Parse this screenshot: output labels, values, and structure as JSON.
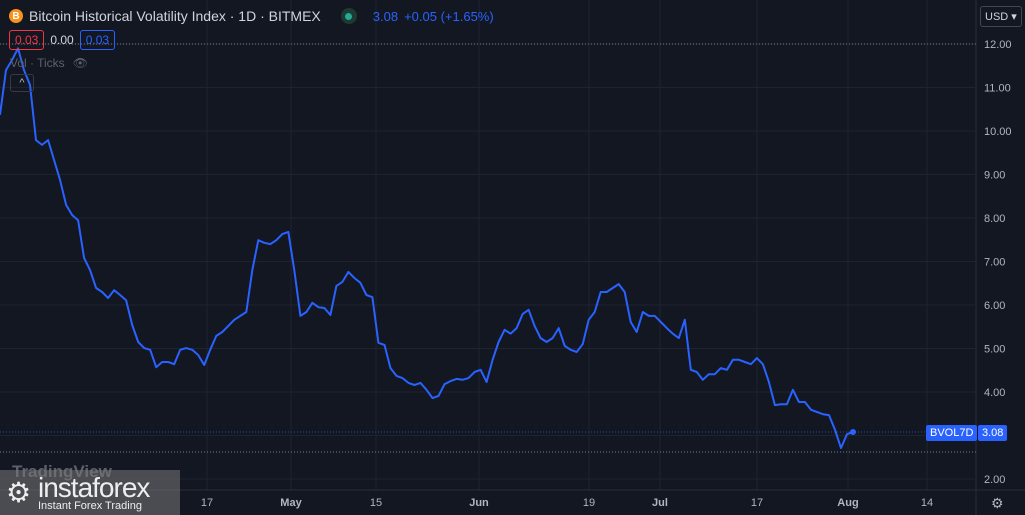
{
  "header": {
    "title": "Bitcoin Historical Volatility Index · 1D · BITMEX",
    "coin_icon": "B",
    "last": "3.08",
    "change": "+0.05 (+1.65%)",
    "box1": "0.03",
    "mid": "0.00",
    "box2": "0.03",
    "vol_label": "Vol · Ticks",
    "currency": "USD"
  },
  "price_tag": {
    "symbol": "BVOL7D",
    "value": "3.08"
  },
  "watermark": {
    "tv": "TradingView",
    "brand": "instaforex",
    "tagline": "Instant Forex Trading"
  },
  "chart_data": {
    "type": "line",
    "series": [
      {
        "name": "BVOL7D",
        "color": "#2962ff",
        "values": [
          10.37,
          11.4,
          11.63,
          11.9,
          11.4,
          11.06,
          9.79,
          9.68,
          9.79,
          9.33,
          8.87,
          8.3,
          8.07,
          7.95,
          7.08,
          6.8,
          6.39,
          6.3,
          6.16,
          6.34,
          6.23,
          6.11,
          5.54,
          5.15,
          5.01,
          4.97,
          4.57,
          4.69,
          4.69,
          4.64,
          4.97,
          5.01,
          4.97,
          4.85,
          4.62,
          4.97,
          5.29,
          5.38,
          5.52,
          5.66,
          5.75,
          5.84,
          6.8,
          7.49,
          7.43,
          7.4,
          7.49,
          7.63,
          7.68,
          6.8,
          5.75,
          5.84,
          6.05,
          5.95,
          5.93,
          5.77,
          6.44,
          6.53,
          6.76,
          6.62,
          6.51,
          6.23,
          6.18,
          5.13,
          5.08,
          4.55,
          4.37,
          4.32,
          4.21,
          4.16,
          4.21,
          4.05,
          3.86,
          3.91,
          4.18,
          4.25,
          4.3,
          4.28,
          4.32,
          4.46,
          4.51,
          4.23,
          4.74,
          5.15,
          5.43,
          5.34,
          5.47,
          5.79,
          5.89,
          5.52,
          5.24,
          5.15,
          5.24,
          5.47,
          5.06,
          4.97,
          4.92,
          5.1,
          5.66,
          5.84,
          6.3,
          6.3,
          6.39,
          6.48,
          6.3,
          5.61,
          5.38,
          5.84,
          5.75,
          5.75,
          5.61,
          5.47,
          5.34,
          5.24,
          5.66,
          4.51,
          4.46,
          4.28,
          4.41,
          4.41,
          4.55,
          4.51,
          4.74,
          4.74,
          4.69,
          4.64,
          4.78,
          4.64,
          4.23,
          3.7,
          3.72,
          3.72,
          4.05,
          3.77,
          3.77,
          3.59,
          3.54,
          3.49,
          3.47,
          3.13,
          2.71,
          3.03,
          3.08
        ]
      }
    ],
    "yticks": [
      "12.00",
      "11.00",
      "10.00",
      "9.00",
      "8.00",
      "7.00",
      "6.00",
      "5.00",
      "4.00",
      "3.00",
      "2.00"
    ],
    "ylim": [
      2,
      12
    ],
    "xticks": [
      "17",
      "May",
      "15",
      "Jun",
      "19",
      "Jul",
      "17",
      "Aug",
      "14"
    ],
    "high_line": 12.0,
    "low_line": 2.62
  }
}
